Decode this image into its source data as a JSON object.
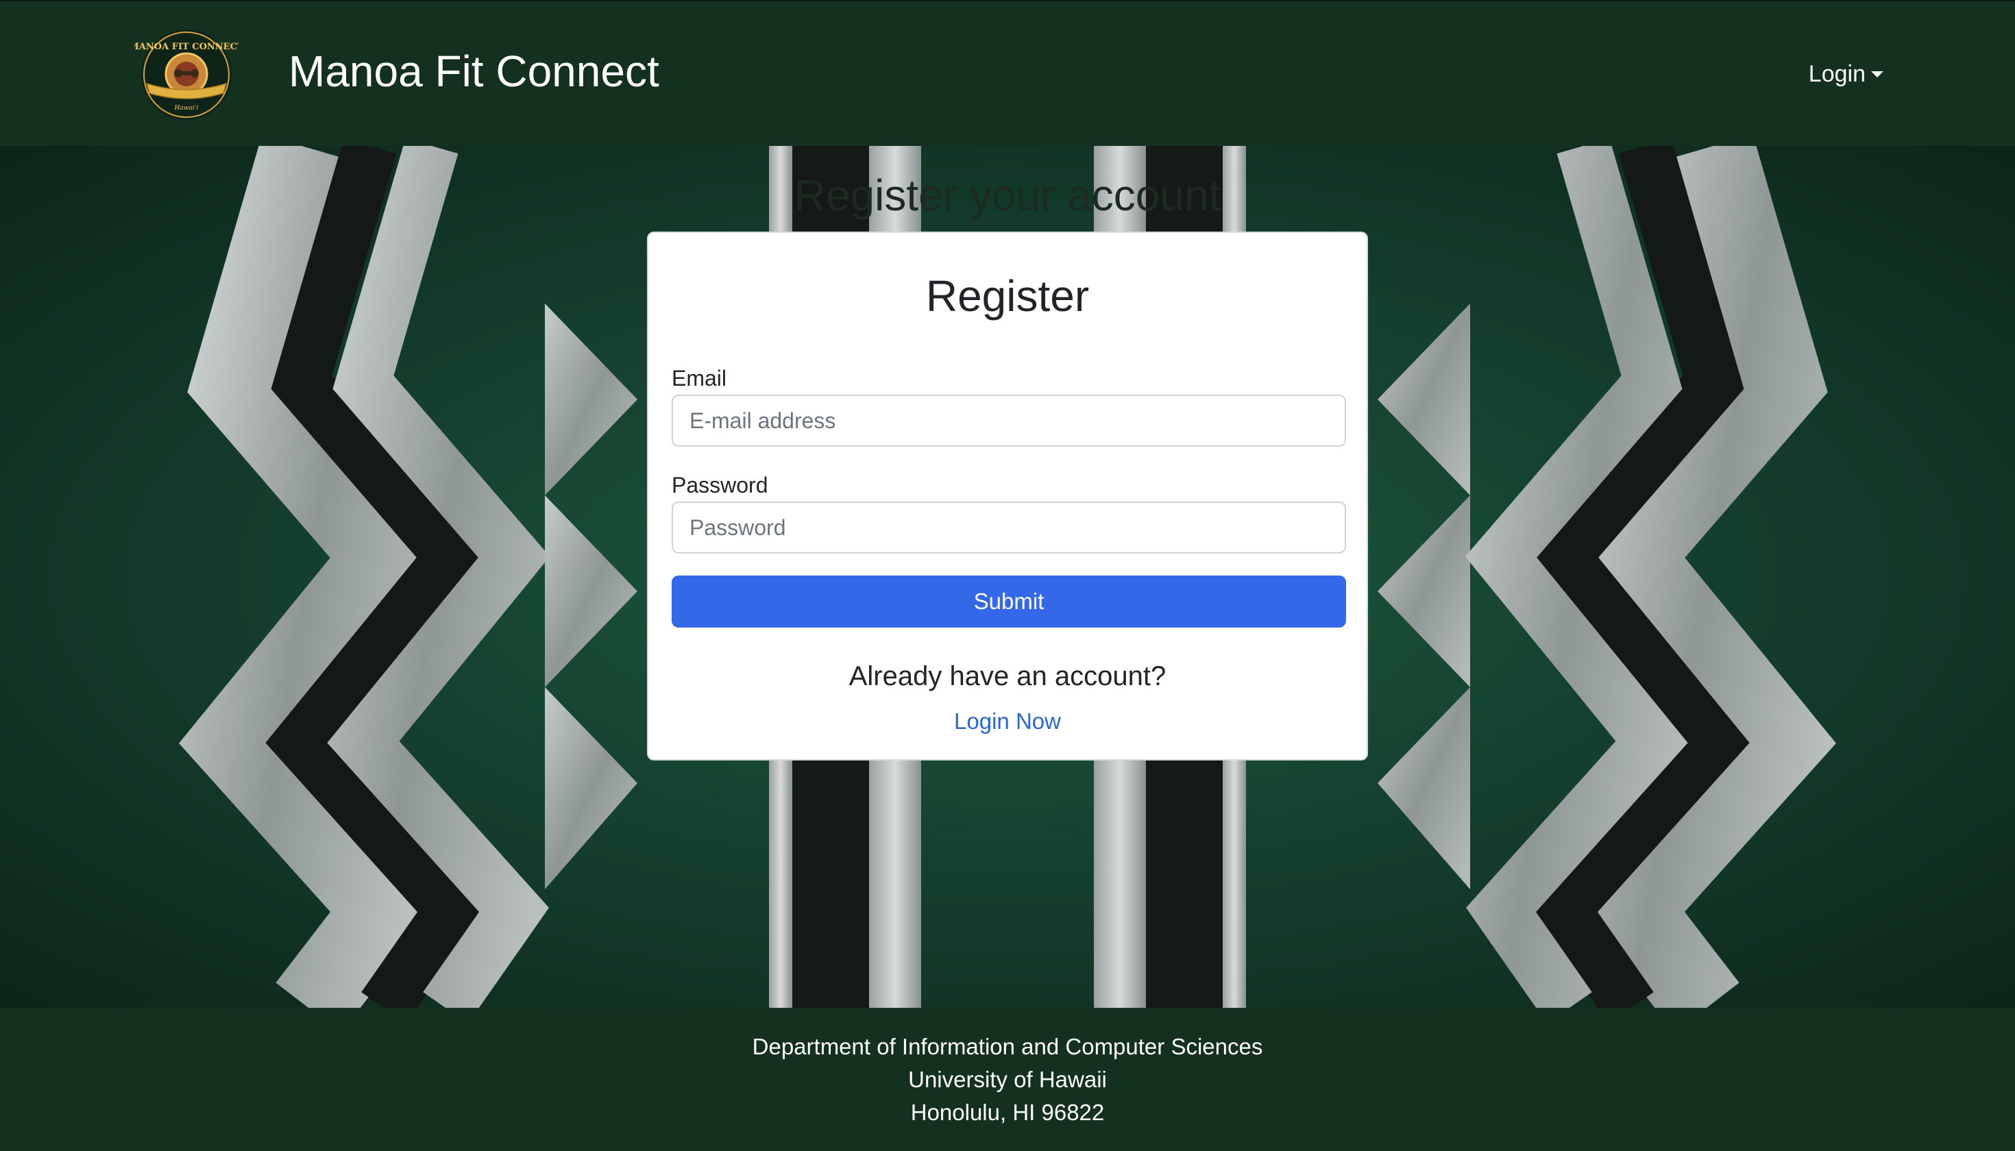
{
  "navbar": {
    "brand": "Manoa Fit Connect",
    "login_menu": "Login",
    "logo_icon": "manoa-fit-connect-seal",
    "logo_text": "MANOA FIT CONNECT",
    "background": "#143120"
  },
  "hero": {
    "ghost_heading": "Register your account"
  },
  "register_card": {
    "title": "Register",
    "email_label": "Email",
    "email_placeholder": "E-mail address",
    "email_value": "",
    "password_label": "Password",
    "password_placeholder": "Password",
    "password_value": "",
    "submit_label": "Submit",
    "already_text": "Already have an account?",
    "login_link": "Login Now",
    "accent": "#3468e8"
  },
  "footer": {
    "line1": "Department of Information and Computer Sciences",
    "line2": "University of Hawaii",
    "line3": "Honolulu, HI 96822"
  }
}
